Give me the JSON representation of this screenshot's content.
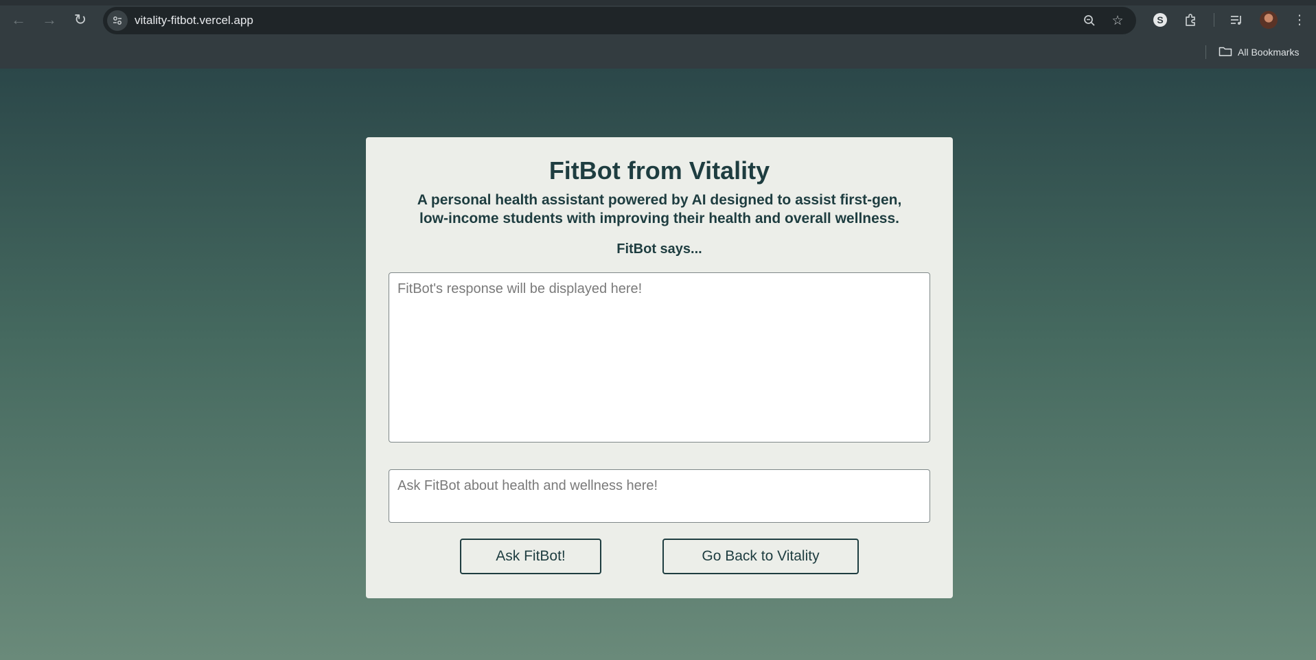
{
  "browser": {
    "url": "vitality-fitbot.vercel.app",
    "bookmarks_label": "All Bookmarks",
    "icons": {
      "back": "back-arrow-icon",
      "forward": "forward-arrow-icon",
      "reload": "reload-icon",
      "site_info": "tune-icon",
      "zoom": "zoom-out-icon",
      "bookmark": "star-icon",
      "extension_s": "s-extension-icon",
      "extensions": "puzzle-icon",
      "reading_list": "media-controls-icon",
      "menu": "kebab-menu-icon",
      "folder": "folder-icon"
    }
  },
  "page": {
    "title": "FitBot from Vitality",
    "subtitle": "A personal health assistant powered by AI designed to assist first-gen, low-income students with improving their health and overall wellness.",
    "says_label": "FitBot says...",
    "response_placeholder": "FitBot's response will be displayed here!",
    "ask_placeholder": "Ask FitBot about health and wellness here!",
    "ask_button": "Ask FitBot!",
    "back_button": "Go Back to Vitality"
  }
}
